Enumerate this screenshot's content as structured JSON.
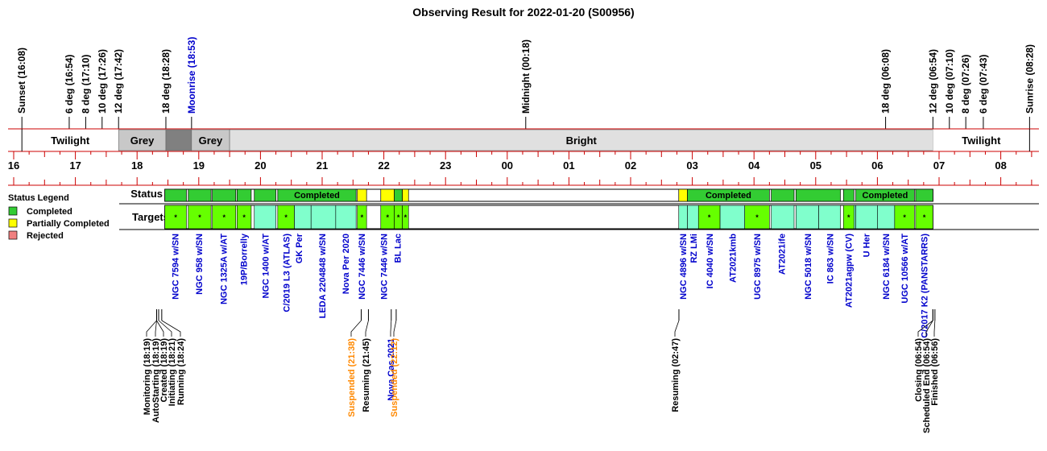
{
  "title": "Observing Result for 2022-01-20 (S00956)",
  "colors": {
    "completed": "#33cc33",
    "partial": "#ffff00",
    "rejected": "#f08080",
    "target_completed": "#66ff00",
    "target_partial": "#80ffcc",
    "twilight_bg": "#ffffff",
    "grey_bg": "#c8c8c8",
    "dark_bg": "#808080",
    "bright_bg": "#e0e0e0",
    "red_line": "#cc0000",
    "link_text": "#0000cc",
    "suspended_text": "#ff8800"
  },
  "chart_data": {
    "type": "timeline",
    "x_unit": "hour (local time)",
    "x_range": [
      15.9,
      8.75
    ],
    "hour_ticks": [
      "16",
      "17",
      "18",
      "19",
      "20",
      "21",
      "22",
      "23",
      "00",
      "01",
      "02",
      "03",
      "04",
      "05",
      "06",
      "07",
      "08"
    ],
    "top_events": [
      {
        "t": 16.133,
        "label": "Sunset (16:08)",
        "color": "#000000"
      },
      {
        "t": 16.9,
        "label": "6 deg (16:54)",
        "color": "#000000"
      },
      {
        "t": 17.167,
        "label": "8 deg (17:10)",
        "color": "#000000"
      },
      {
        "t": 17.433,
        "label": "10 deg (17:26)",
        "color": "#000000"
      },
      {
        "t": 17.7,
        "label": "12 deg (17:42)",
        "color": "#000000"
      },
      {
        "t": 18.467,
        "label": "18 deg (18:28)",
        "color": "#000000"
      },
      {
        "t": 18.883,
        "label": "Moonrise (18:53)",
        "color": "#0000cc"
      },
      {
        "t": 24.3,
        "label": "Midnight (00:18)",
        "color": "#000000"
      },
      {
        "t": 30.133,
        "label": "18 deg (06:08)",
        "color": "#000000"
      },
      {
        "t": 30.9,
        "label": "12 deg (06:54)",
        "color": "#000000"
      },
      {
        "t": 31.167,
        "label": "10 deg (07:10)",
        "color": "#000000"
      },
      {
        "t": 31.433,
        "label": "8 deg (07:26)",
        "color": "#000000"
      },
      {
        "t": 31.717,
        "label": "6 deg (07:43)",
        "color": "#000000"
      },
      {
        "t": 32.467,
        "label": "Sunrise (08:28)",
        "color": "#000000"
      }
    ],
    "sky_segments": [
      {
        "start": 16.133,
        "end": 17.7,
        "label": "Twilight",
        "kind": "twilight"
      },
      {
        "start": 17.7,
        "end": 18.467,
        "label": "Grey",
        "kind": "grey"
      },
      {
        "start": 18.467,
        "end": 18.883,
        "label": "",
        "kind": "dark"
      },
      {
        "start": 18.883,
        "end": 19.5,
        "label": "Grey",
        "kind": "grey"
      },
      {
        "start": 19.5,
        "end": 30.9,
        "label": "Bright",
        "kind": "bright"
      },
      {
        "start": 30.9,
        "end": 32.467,
        "label": "Twilight",
        "kind": "twilight"
      }
    ],
    "legend": {
      "title": "Status Legend",
      "items": [
        {
          "label": "Completed",
          "key": "completed"
        },
        {
          "label": "Partially Completed",
          "key": "partial"
        },
        {
          "label": "Rejected",
          "key": "rejected"
        }
      ]
    },
    "row_labels": {
      "status": "Status",
      "targets": "Targets"
    },
    "status_blocks": [
      {
        "start": 18.45,
        "end": 18.8,
        "status": "completed",
        "label": ""
      },
      {
        "start": 18.83,
        "end": 19.2,
        "status": "completed",
        "label": ""
      },
      {
        "start": 19.22,
        "end": 19.6,
        "status": "completed",
        "label": ""
      },
      {
        "start": 19.62,
        "end": 19.85,
        "status": "completed",
        "label": ""
      },
      {
        "start": 19.9,
        "end": 20.25,
        "status": "completed",
        "label": ""
      },
      {
        "start": 20.28,
        "end": 21.55,
        "status": "completed",
        "label": "Completed"
      },
      {
        "start": 21.57,
        "end": 21.72,
        "status": "partial",
        "label": ""
      },
      {
        "start": 21.95,
        "end": 22.17,
        "status": "partial",
        "label": ""
      },
      {
        "start": 22.17,
        "end": 22.3,
        "status": "completed",
        "label": ""
      },
      {
        "start": 22.3,
        "end": 22.4,
        "status": "partial",
        "label": ""
      },
      {
        "start": 26.78,
        "end": 26.92,
        "status": "partial",
        "label": ""
      },
      {
        "start": 26.92,
        "end": 28.25,
        "status": "completed",
        "label": "Completed"
      },
      {
        "start": 28.28,
        "end": 28.65,
        "status": "completed",
        "label": ""
      },
      {
        "start": 28.68,
        "end": 29.4,
        "status": "completed",
        "label": ""
      },
      {
        "start": 29.45,
        "end": 29.62,
        "status": "completed",
        "label": ""
      },
      {
        "start": 29.65,
        "end": 30.6,
        "status": "completed",
        "label": "Completed"
      },
      {
        "start": 30.62,
        "end": 30.9,
        "status": "completed",
        "label": ""
      }
    ],
    "target_blocks": [
      {
        "start": 18.45,
        "end": 18.8,
        "kind": "completed",
        "star": true
      },
      {
        "start": 18.83,
        "end": 19.2,
        "kind": "completed",
        "star": true
      },
      {
        "start": 19.22,
        "end": 19.6,
        "kind": "completed",
        "star": true
      },
      {
        "start": 19.62,
        "end": 19.85,
        "kind": "completed",
        "star": true
      },
      {
        "start": 19.9,
        "end": 20.25,
        "kind": "partial",
        "star": false
      },
      {
        "start": 20.28,
        "end": 20.55,
        "kind": "completed",
        "star": true
      },
      {
        "start": 20.55,
        "end": 20.82,
        "kind": "partial",
        "star": false
      },
      {
        "start": 20.82,
        "end": 21.22,
        "kind": "partial",
        "star": false
      },
      {
        "start": 21.22,
        "end": 21.55,
        "kind": "partial",
        "star": false
      },
      {
        "start": 21.57,
        "end": 21.72,
        "kind": "completed",
        "star": true
      },
      {
        "start": 21.95,
        "end": 22.17,
        "kind": "completed",
        "star": true
      },
      {
        "start": 22.17,
        "end": 22.3,
        "kind": "completed",
        "star": true
      },
      {
        "start": 22.3,
        "end": 22.4,
        "kind": "completed",
        "star": true
      },
      {
        "start": 26.78,
        "end": 26.92,
        "kind": "partial",
        "star": false
      },
      {
        "start": 26.92,
        "end": 27.1,
        "kind": "partial",
        "star": false
      },
      {
        "start": 27.1,
        "end": 27.45,
        "kind": "completed",
        "star": true
      },
      {
        "start": 27.45,
        "end": 27.85,
        "kind": "partial",
        "star": false
      },
      {
        "start": 27.85,
        "end": 28.25,
        "kind": "completed",
        "star": true
      },
      {
        "start": 28.28,
        "end": 28.65,
        "kind": "partial",
        "star": false
      },
      {
        "start": 28.68,
        "end": 29.05,
        "kind": "partial",
        "star": false
      },
      {
        "start": 29.05,
        "end": 29.4,
        "kind": "partial",
        "star": false
      },
      {
        "start": 29.45,
        "end": 29.62,
        "kind": "completed",
        "star": true
      },
      {
        "start": 29.62,
        "end": 29.65,
        "kind": "partial",
        "star": false
      },
      {
        "start": 29.65,
        "end": 30.0,
        "kind": "partial",
        "star": false
      },
      {
        "start": 30.0,
        "end": 30.28,
        "kind": "partial",
        "star": false
      },
      {
        "start": 30.28,
        "end": 30.6,
        "kind": "completed",
        "star": true
      },
      {
        "start": 30.62,
        "end": 30.9,
        "kind": "completed",
        "star": true
      }
    ],
    "star_glyph": "*",
    "target_labels": [
      {
        "t": 18.62,
        "label": "NGC 7594 w/SN"
      },
      {
        "t": 19.0,
        "label": "NGC 958  w/SN"
      },
      {
        "t": 19.4,
        "label": "NGC 1325A w/AT"
      },
      {
        "t": 19.73,
        "label": "19P/Borrelly"
      },
      {
        "t": 20.08,
        "label": "NGC 1400 w/AT"
      },
      {
        "t": 20.42,
        "label": "C/2019 L3 (ATLAS)"
      },
      {
        "t": 20.62,
        "label": "GK Per"
      },
      {
        "t": 21.0,
        "label": "LEDA 2204848 w/SN"
      },
      {
        "t": 21.38,
        "label": "Nova Per 2020"
      },
      {
        "t": 21.64,
        "label": "NGC 7446 w/SN"
      },
      {
        "t": 22.0,
        "label": "NGC 7446 w/SN"
      },
      {
        "t": 22.22,
        "label": "BL Lac"
      },
      {
        "t": 26.85,
        "label": "NGC 4896 w/SN"
      },
      {
        "t": 27.02,
        "label": "RZ LMi"
      },
      {
        "t": 27.28,
        "label": "IC 4040 w/SN"
      },
      {
        "t": 27.65,
        "label": "AT2021kmb"
      },
      {
        "t": 28.05,
        "label": "UGC 8975 w/SN"
      },
      {
        "t": 28.45,
        "label": "AT2021ife"
      },
      {
        "t": 28.87,
        "label": "NGC 5018 w/SN"
      },
      {
        "t": 29.23,
        "label": "IC 863  w/SN"
      },
      {
        "t": 29.53,
        "label": "AT2021agpw (CV)"
      },
      {
        "t": 29.82,
        "label": "U Her"
      },
      {
        "t": 30.14,
        "label": "NGC 6184 w/SN"
      },
      {
        "t": 30.44,
        "label": "UGC 10566 w/AT"
      },
      {
        "t": 30.76,
        "label": "C/2017 K2 (PANSTARRS)"
      }
    ],
    "bottom_events": [
      {
        "t": 18.317,
        "label": "Monitoring (18:19)",
        "color": "#000000"
      },
      {
        "t": 18.317,
        "label": "AutoStarting (18:19)",
        "color": "#000000"
      },
      {
        "t": 18.317,
        "label": "Created (18:19)",
        "color": "#000000"
      },
      {
        "t": 18.35,
        "label": "Initiating (18:21)",
        "color": "#000000"
      },
      {
        "t": 18.4,
        "label": "Running (18:24)",
        "color": "#000000"
      },
      {
        "t": 21.633,
        "label": "Suspended (21:38)",
        "color": "#ff8800"
      },
      {
        "t": 21.75,
        "label": "Resuming (21:45)",
        "color": "#000000"
      },
      {
        "t": 22.12,
        "label": "Nova Cas 2021",
        "color": "#0000cc"
      },
      {
        "t": 22.2,
        "label": "Suspended (22:12)",
        "color": "#ff8800"
      },
      {
        "t": 26.783,
        "label": "Resuming (02:47)",
        "color": "#000000"
      },
      {
        "t": 30.9,
        "label": "Closing (06:54)",
        "color": "#000000"
      },
      {
        "t": 30.9,
        "label": "Scheduled End (06:54)",
        "color": "#000000"
      },
      {
        "t": 30.933,
        "label": "Finished (06:56)",
        "color": "#000000"
      }
    ]
  }
}
